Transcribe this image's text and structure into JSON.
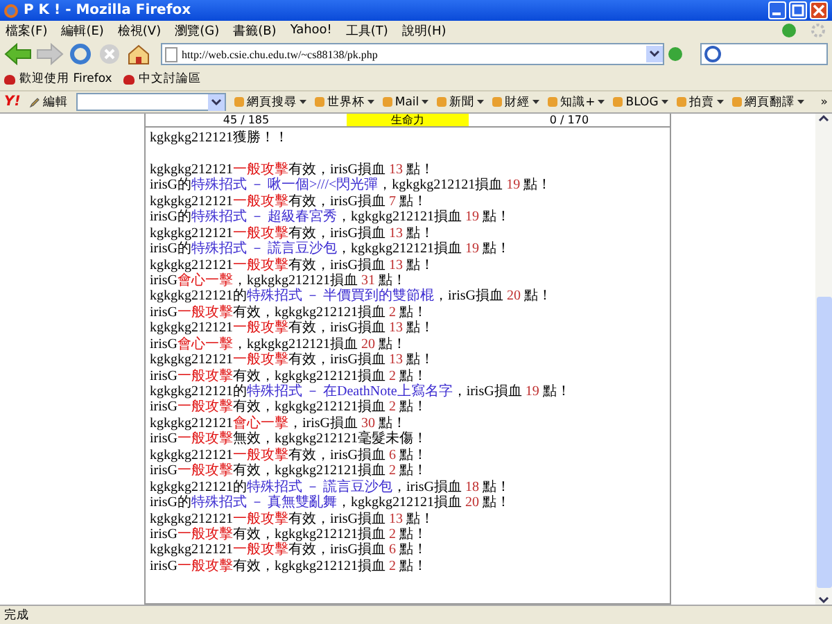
{
  "window": {
    "title": "P K ! - Mozilla Firefox"
  },
  "menu": [
    "檔案(F)",
    "編輯(E)",
    "檢視(V)",
    "瀏覽(G)",
    "書籤(B)",
    "Yahoo!",
    "工具(T)",
    "說明(H)"
  ],
  "address": {
    "value": "http://web.csie.chu.edu.tw/~cs88138/pk.php"
  },
  "bookmarks": [
    "歡迎使用 Firefox",
    "中文討論區"
  ],
  "yahoo_toolbar": {
    "logo": "Y!",
    "edit": "編輯",
    "items": [
      "網頁搜尋",
      "世界杯",
      "Mail",
      "新聞",
      "財經",
      "知識+",
      "BLOG",
      "拍賣",
      "網頁翻譯"
    ],
    "more": "»"
  },
  "stats_row": [
    {
      "text": "45 / 185",
      "kind": "plain"
    },
    {
      "text": "生命力",
      "kind": "highlight"
    },
    {
      "text": "0 / 170",
      "kind": "plain"
    }
  ],
  "result": "kgkgkg212121獲勝！！",
  "log": [
    [
      {
        "text": "kgkgkg212121",
        "kind": "plain"
      },
      {
        "text": "一般攻擊",
        "kind": "attack"
      },
      {
        "text": "有效，irisG損血 ",
        "kind": "plain"
      },
      {
        "text": "13",
        "kind": "damage"
      },
      {
        "text": " 點！",
        "kind": "plain"
      }
    ],
    [
      {
        "text": "irisG的",
        "kind": "plain"
      },
      {
        "text": "特殊招式 － 啾一個>///<閃光彈",
        "kind": "skill"
      },
      {
        "text": "，kgkgkg212121損血 ",
        "kind": "plain"
      },
      {
        "text": "19",
        "kind": "damage"
      },
      {
        "text": " 點！",
        "kind": "plain"
      }
    ],
    [
      {
        "text": "kgkgkg212121",
        "kind": "plain"
      },
      {
        "text": "一般攻擊",
        "kind": "attack"
      },
      {
        "text": "有效，irisG損血 ",
        "kind": "plain"
      },
      {
        "text": "7",
        "kind": "damage"
      },
      {
        "text": " 點！",
        "kind": "plain"
      }
    ],
    [
      {
        "text": "irisG的",
        "kind": "plain"
      },
      {
        "text": "特殊招式 － 超級春宮秀",
        "kind": "skill"
      },
      {
        "text": "，kgkgkg212121損血 ",
        "kind": "plain"
      },
      {
        "text": "19",
        "kind": "damage"
      },
      {
        "text": " 點！",
        "kind": "plain"
      }
    ],
    [
      {
        "text": "kgkgkg212121",
        "kind": "plain"
      },
      {
        "text": "一般攻擊",
        "kind": "attack"
      },
      {
        "text": "有效，irisG損血 ",
        "kind": "plain"
      },
      {
        "text": "13",
        "kind": "damage"
      },
      {
        "text": " 點！",
        "kind": "plain"
      }
    ],
    [
      {
        "text": "irisG的",
        "kind": "plain"
      },
      {
        "text": "特殊招式 － 謊言豆沙包",
        "kind": "skill"
      },
      {
        "text": "，kgkgkg212121損血 ",
        "kind": "plain"
      },
      {
        "text": "19",
        "kind": "damage"
      },
      {
        "text": " 點！",
        "kind": "plain"
      }
    ],
    [
      {
        "text": "kgkgkg212121",
        "kind": "plain"
      },
      {
        "text": "一般攻擊",
        "kind": "attack"
      },
      {
        "text": "有效，irisG損血 ",
        "kind": "plain"
      },
      {
        "text": "13",
        "kind": "damage"
      },
      {
        "text": " 點！",
        "kind": "plain"
      }
    ],
    [
      {
        "text": "irisG",
        "kind": "plain"
      },
      {
        "text": "會心一擊",
        "kind": "attack"
      },
      {
        "text": "，kgkgkg212121損血 ",
        "kind": "plain"
      },
      {
        "text": "31",
        "kind": "damage"
      },
      {
        "text": " 點！",
        "kind": "plain"
      }
    ],
    [
      {
        "text": "kgkgkg212121的",
        "kind": "plain"
      },
      {
        "text": "特殊招式 － 半價買到的雙節棍",
        "kind": "skill"
      },
      {
        "text": "，irisG損血 ",
        "kind": "plain"
      },
      {
        "text": "20",
        "kind": "damage"
      },
      {
        "text": " 點！",
        "kind": "plain"
      }
    ],
    [
      {
        "text": "irisG",
        "kind": "plain"
      },
      {
        "text": "一般攻擊",
        "kind": "attack"
      },
      {
        "text": "有效，kgkgkg212121損血 ",
        "kind": "plain"
      },
      {
        "text": "2",
        "kind": "damage"
      },
      {
        "text": " 點！",
        "kind": "plain"
      }
    ],
    [
      {
        "text": "kgkgkg212121",
        "kind": "plain"
      },
      {
        "text": "一般攻擊",
        "kind": "attack"
      },
      {
        "text": "有效，irisG損血 ",
        "kind": "plain"
      },
      {
        "text": "13",
        "kind": "damage"
      },
      {
        "text": " 點！",
        "kind": "plain"
      }
    ],
    [
      {
        "text": "irisG",
        "kind": "plain"
      },
      {
        "text": "會心一擊",
        "kind": "attack"
      },
      {
        "text": "，kgkgkg212121損血 ",
        "kind": "plain"
      },
      {
        "text": "20",
        "kind": "damage"
      },
      {
        "text": " 點！",
        "kind": "plain"
      }
    ],
    [
      {
        "text": "kgkgkg212121",
        "kind": "plain"
      },
      {
        "text": "一般攻擊",
        "kind": "attack"
      },
      {
        "text": "有效，irisG損血 ",
        "kind": "plain"
      },
      {
        "text": "13",
        "kind": "damage"
      },
      {
        "text": " 點！",
        "kind": "plain"
      }
    ],
    [
      {
        "text": "irisG",
        "kind": "plain"
      },
      {
        "text": "一般攻擊",
        "kind": "attack"
      },
      {
        "text": "有效，kgkgkg212121損血 ",
        "kind": "plain"
      },
      {
        "text": "2",
        "kind": "damage"
      },
      {
        "text": " 點！",
        "kind": "plain"
      }
    ],
    [
      {
        "text": "kgkgkg212121的",
        "kind": "plain"
      },
      {
        "text": "特殊招式 － 在DeathNote上寫名字",
        "kind": "skill"
      },
      {
        "text": "，irisG損血 ",
        "kind": "plain"
      },
      {
        "text": "19",
        "kind": "damage"
      },
      {
        "text": " 點！",
        "kind": "plain"
      }
    ],
    [
      {
        "text": "irisG",
        "kind": "plain"
      },
      {
        "text": "一般攻擊",
        "kind": "attack"
      },
      {
        "text": "有效，kgkgkg212121損血 ",
        "kind": "plain"
      },
      {
        "text": "2",
        "kind": "damage"
      },
      {
        "text": " 點！",
        "kind": "plain"
      }
    ],
    [
      {
        "text": "kgkgkg212121",
        "kind": "plain"
      },
      {
        "text": "會心一擊",
        "kind": "attack"
      },
      {
        "text": "，irisG損血 ",
        "kind": "plain"
      },
      {
        "text": "30",
        "kind": "damage"
      },
      {
        "text": " 點！",
        "kind": "plain"
      }
    ],
    [
      {
        "text": "irisG",
        "kind": "plain"
      },
      {
        "text": "一般攻擊",
        "kind": "attack"
      },
      {
        "text": "無效，kgkgkg212121毫髮未傷！",
        "kind": "plain"
      }
    ],
    [
      {
        "text": "kgkgkg212121",
        "kind": "plain"
      },
      {
        "text": "一般攻擊",
        "kind": "attack"
      },
      {
        "text": "有效，irisG損血 ",
        "kind": "plain"
      },
      {
        "text": "6",
        "kind": "damage"
      },
      {
        "text": " 點！",
        "kind": "plain"
      }
    ],
    [
      {
        "text": "irisG",
        "kind": "plain"
      },
      {
        "text": "一般攻擊",
        "kind": "attack"
      },
      {
        "text": "有效，kgkgkg212121損血 ",
        "kind": "plain"
      },
      {
        "text": "2",
        "kind": "damage"
      },
      {
        "text": " 點！",
        "kind": "plain"
      }
    ],
    [
      {
        "text": "kgkgkg212121的",
        "kind": "plain"
      },
      {
        "text": "特殊招式 － 謊言豆沙包",
        "kind": "skill"
      },
      {
        "text": "，irisG損血 ",
        "kind": "plain"
      },
      {
        "text": "18",
        "kind": "damage"
      },
      {
        "text": " 點！",
        "kind": "plain"
      }
    ],
    [
      {
        "text": "irisG的",
        "kind": "plain"
      },
      {
        "text": "特殊招式 － 真無雙亂舞",
        "kind": "skill"
      },
      {
        "text": "，kgkgkg212121損血 ",
        "kind": "plain"
      },
      {
        "text": "20",
        "kind": "damage"
      },
      {
        "text": " 點！",
        "kind": "plain"
      }
    ],
    [
      {
        "text": "kgkgkg212121",
        "kind": "plain"
      },
      {
        "text": "一般攻擊",
        "kind": "attack"
      },
      {
        "text": "有效，irisG損血 ",
        "kind": "plain"
      },
      {
        "text": "13",
        "kind": "damage"
      },
      {
        "text": " 點！",
        "kind": "plain"
      }
    ],
    [
      {
        "text": "irisG",
        "kind": "plain"
      },
      {
        "text": "一般攻擊",
        "kind": "attack"
      },
      {
        "text": "有效，kgkgkg212121損血 ",
        "kind": "plain"
      },
      {
        "text": "2",
        "kind": "damage"
      },
      {
        "text": " 點！",
        "kind": "plain"
      }
    ],
    [
      {
        "text": "kgkgkg212121",
        "kind": "plain"
      },
      {
        "text": "一般攻擊",
        "kind": "attack"
      },
      {
        "text": "有效，irisG損血 ",
        "kind": "plain"
      },
      {
        "text": "6",
        "kind": "damage"
      },
      {
        "text": " 點！",
        "kind": "plain"
      }
    ],
    [
      {
        "text": "irisG",
        "kind": "plain"
      },
      {
        "text": "一般攻擊",
        "kind": "attack"
      },
      {
        "text": "有效，kgkgkg212121損血 ",
        "kind": "plain"
      },
      {
        "text": "2",
        "kind": "damage"
      },
      {
        "text": " 點！",
        "kind": "plain"
      }
    ]
  ],
  "status_bar": "完成"
}
